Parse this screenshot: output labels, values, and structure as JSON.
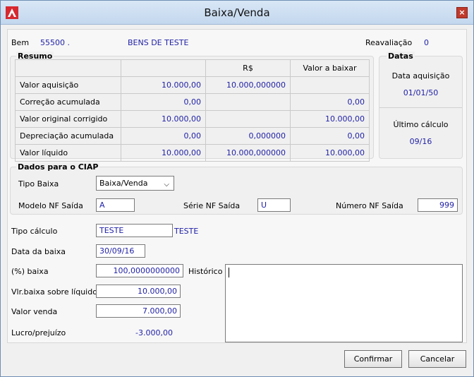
{
  "window": {
    "title": "Baixa/Venda",
    "close_label": "×"
  },
  "header": {
    "bem_label": "Bem",
    "bem_code": "55500 .",
    "bem_name": "BENS DE TESTE",
    "reavaliacao_label": "Reavaliação",
    "reavaliacao_value": "0"
  },
  "resumo": {
    "title": "Resumo",
    "headers": [
      "",
      "",
      "R$",
      "Valor a baixar"
    ],
    "rows": [
      {
        "label": "Valor aquisição",
        "c1": "10.000,00",
        "c2": "10.000,000000",
        "c3": ""
      },
      {
        "label": "Correção acumulada",
        "c1": "0,00",
        "c2": "",
        "c3": "0,00"
      },
      {
        "label": "Valor original corrigido",
        "c1": "10.000,00",
        "c2": "",
        "c3": "10.000,00"
      },
      {
        "label": "Depreciação acumulada",
        "c1": "0,00",
        "c2": "0,000000",
        "c3": "0,00"
      },
      {
        "label": "Valor líquido",
        "c1": "10.000,00",
        "c2": "10.000,000000",
        "c3": "10.000,00"
      }
    ]
  },
  "datas": {
    "title": "Datas",
    "data_aquisicao_label": "Data aquisição",
    "data_aquisicao_value": "01/01/50",
    "ultimo_calculo_label": "Último cálculo",
    "ultimo_calculo_value": "09/16"
  },
  "ciap": {
    "title": "Dados para o CIAP",
    "tipo_baixa_label": "Tipo Baixa",
    "tipo_baixa_value": "Baixa/Venda",
    "modelo_label": "Modelo NF Saída",
    "modelo_value": "A",
    "serie_label": "Série NF Saída",
    "serie_value": "U",
    "numero_label": "Número NF Saída",
    "numero_value": "999"
  },
  "form": {
    "tipo_calculo_label": "Tipo cálculo",
    "tipo_calculo_value": "TESTE",
    "tipo_calculo_desc": "TESTE",
    "data_baixa_label": "Data da baixa",
    "data_baixa_value": "30/09/16",
    "perc_baixa_label": "(%) baixa",
    "perc_baixa_value": "100,0000000000",
    "historico_label": "Histórico",
    "vlr_baixa_label": "Vlr.baixa sobre líquido",
    "vlr_baixa_value": "10.000,00",
    "valor_venda_label": "Valor venda",
    "valor_venda_value": "7.000,00",
    "lucro_label": "Lucro/prejuízo",
    "lucro_value": "-3.000,00"
  },
  "buttons": {
    "confirm_label": "Confirmar",
    "cancel_label": "Cancelar"
  }
}
